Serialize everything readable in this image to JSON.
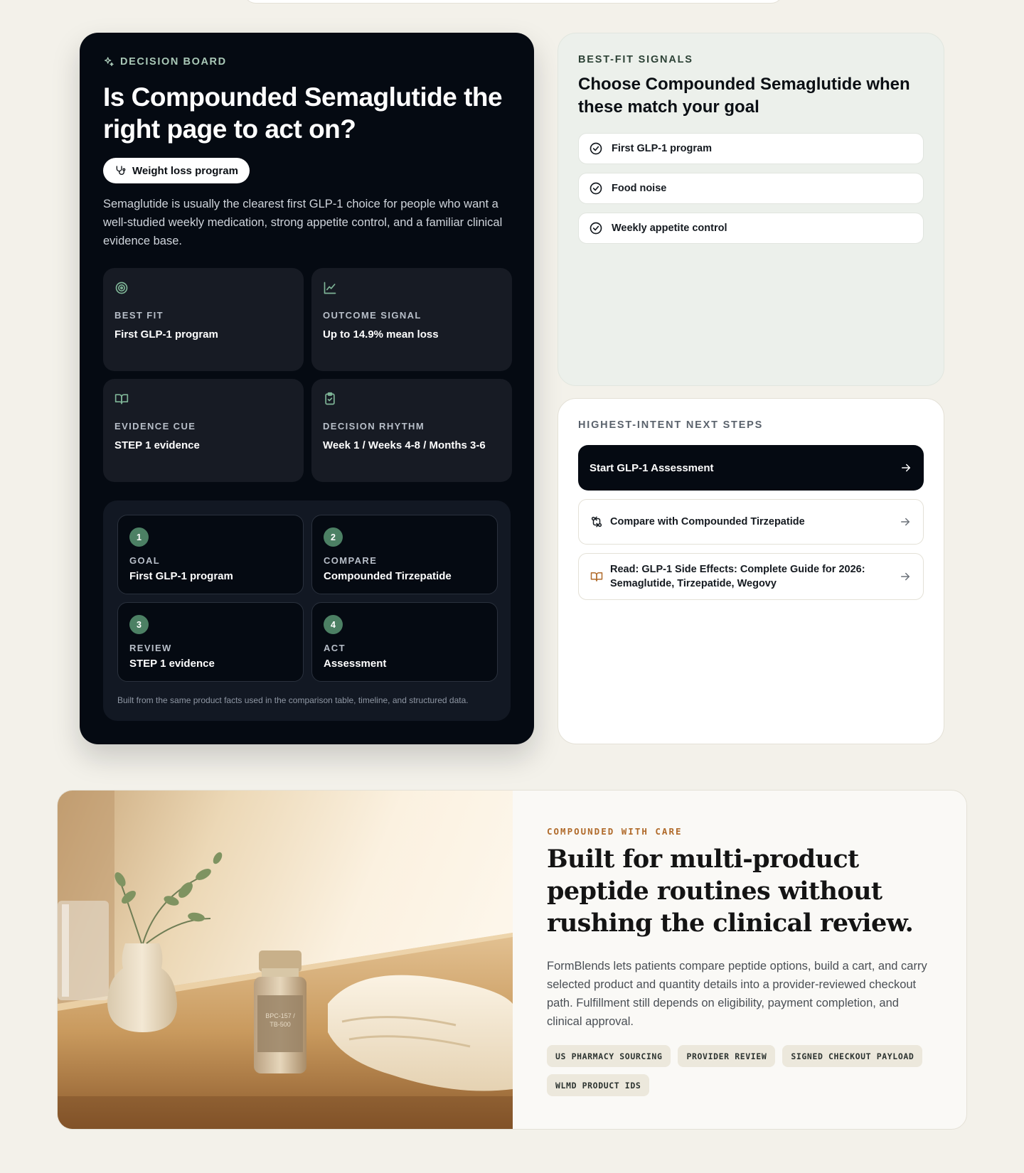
{
  "decision_board": {
    "eyebrow": "DECISION BOARD",
    "eyebrow_icon": "sparkles-icon",
    "title": "Is Compounded Semaglutide the right page to act on?",
    "pill_label": "Weight loss program",
    "pill_icon": "stethoscope-icon",
    "description": "Semaglutide is usually the clearest first GLP-1 choice for people who want a well-studied weekly medication, strong appetite control, and a familiar clinical evidence base.",
    "cards": [
      {
        "icon": "target-icon",
        "label": "BEST FIT",
        "value": "First GLP-1 program"
      },
      {
        "icon": "line-chart-icon",
        "label": "OUTCOME SIGNAL",
        "value": "Up to 14.9% mean loss"
      },
      {
        "icon": "book-open-icon",
        "label": "EVIDENCE CUE",
        "value": "STEP 1 evidence"
      },
      {
        "icon": "clipboard-check-icon",
        "label": "DECISION RHYTHM",
        "value": "Week 1 / Weeks 4-8 / Months 3-6"
      }
    ],
    "steps": [
      {
        "num": "1",
        "label": "GOAL",
        "value": "First GLP-1 program"
      },
      {
        "num": "2",
        "label": "COMPARE",
        "value": "Compounded Tirzepatide"
      },
      {
        "num": "3",
        "label": "REVIEW",
        "value": "STEP 1 evidence"
      },
      {
        "num": "4",
        "label": "ACT",
        "value": "Assessment"
      }
    ],
    "steps_note": "Built from the same product facts used in the comparison table, timeline, and structured data."
  },
  "best_fit": {
    "eyebrow": "BEST-FIT SIGNALS",
    "title": "Choose Compounded Semaglutide when these match your goal",
    "items": [
      "First GLP-1 program",
      "Food noise",
      "Weekly appetite control"
    ]
  },
  "next_steps": {
    "eyebrow": "HIGHEST-INTENT NEXT STEPS",
    "primary": "Start GLP-1 Assessment",
    "compare": "Compare with Compounded Tirzepatide",
    "read": "Read: GLP-1 Side Effects: Complete Guide for 2026: Semaglutide, Tirzepatide, Wegovy"
  },
  "feature": {
    "eyebrow": "COMPOUNDED WITH CARE",
    "title": "Built for multi-product peptide routines without rushing the clinical review.",
    "description": "FormBlends lets patients compare peptide options, build a cart, and carry selected product and quantity details into a provider-reviewed checkout path. Fulfillment still depends on eligibility, payment completion, and clinical approval.",
    "tags": [
      "US PHARMACY SOURCING",
      "PROVIDER REVIEW",
      "SIGNED CHECKOUT PAYLOAD",
      "WLMD PRODUCT IDS"
    ],
    "vial_label_1": "BPC-157 /",
    "vial_label_2": "TB-500"
  },
  "colors": {
    "board_bg": "#050a12",
    "accent_green": "#4c8064",
    "eyebrow_orange": "#b06a2a",
    "page_bg": "#f3f1ea"
  }
}
